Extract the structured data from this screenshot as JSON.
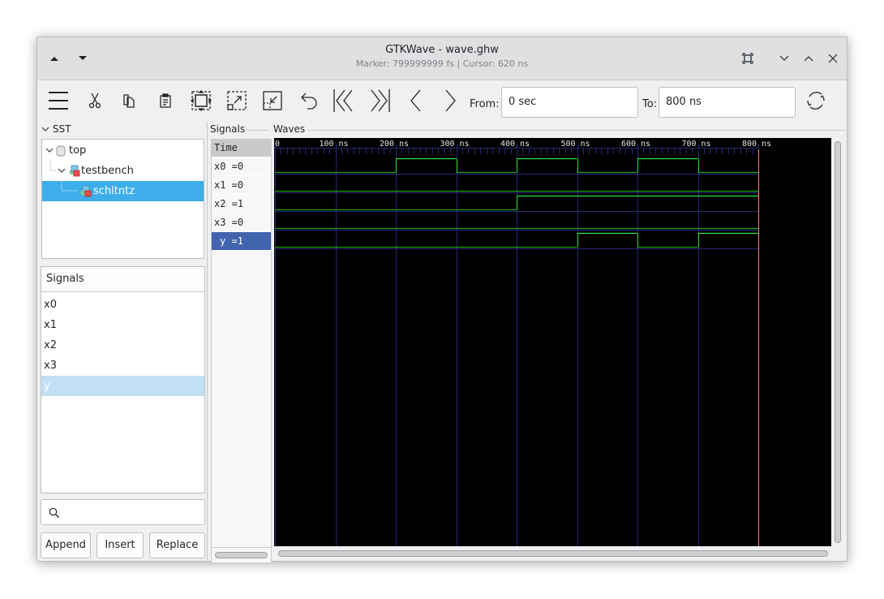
{
  "window": {
    "title": "GTKWave - wave.ghw",
    "subtitle": "Marker: 799999999 fs  |  Cursor: 620 ns"
  },
  "toolbar": {
    "from_label": "From:",
    "from_value": "0 sec",
    "to_label": "To:",
    "to_value": "800 ns",
    "icons": [
      "menu-icon",
      "cut-icon",
      "copy-icon",
      "paste-icon",
      "zoom-fit-icon",
      "zoom-in-icon",
      "zoom-out-icon",
      "undo-icon",
      "first-icon",
      "last-icon",
      "prev-icon",
      "next-icon",
      "reload-icon"
    ]
  },
  "sst": {
    "label": "SST",
    "tree": [
      {
        "label": "top",
        "level": 0,
        "icon": "database-icon",
        "expanded": true
      },
      {
        "label": "testbench",
        "level": 1,
        "icon": "module-icon",
        "expanded": true
      },
      {
        "label": "schltntz",
        "level": 2,
        "icon": "module-icon",
        "selected": true
      }
    ]
  },
  "signals_list": {
    "header": "Signals",
    "items": [
      "x0",
      "x1",
      "x2",
      "x3",
      "y"
    ],
    "selected_index": 4
  },
  "search": {
    "placeholder": ""
  },
  "buttons": {
    "append": "Append",
    "insert": "Insert",
    "replace": "Replace"
  },
  "signals_panel": {
    "label": "Signals",
    "time_label": "Time",
    "rows": [
      {
        "name": "x0",
        "value": "0",
        "text": "x0 =0"
      },
      {
        "name": "x1",
        "value": "0",
        "text": "x1 =0"
      },
      {
        "name": "x2",
        "value": "1",
        "text": "x2 =1"
      },
      {
        "name": "x3",
        "value": "0",
        "text": "x3 =0"
      },
      {
        "name": "y",
        "value": "1",
        "text": "y =1",
        "selected": true
      }
    ]
  },
  "waves": {
    "label": "Waves",
    "colors": {
      "background": "#000000",
      "grid": "#262678",
      "high": "#33e033",
      "low": "#1f9e1f",
      "marker": "#ff8080",
      "tick_text": "#e0e0e0"
    },
    "time_unit": "ns",
    "time_range": [
      0,
      800
    ],
    "marker_time": 800,
    "tick_labels": [
      "0",
      "100 ns",
      "200 ns",
      "300 ns",
      "400 ns",
      "500 ns",
      "600 ns",
      "700 ns",
      "800 ns"
    ],
    "ticks": [
      0,
      100,
      200,
      300,
      400,
      500,
      600,
      700,
      800
    ],
    "signals": [
      {
        "name": "x0",
        "transitions": [
          [
            0,
            0
          ],
          [
            200,
            1
          ],
          [
            300,
            0
          ],
          [
            400,
            1
          ],
          [
            500,
            0
          ],
          [
            600,
            1
          ],
          [
            700,
            0
          ]
        ]
      },
      {
        "name": "x1",
        "transitions": [
          [
            0,
            0
          ]
        ]
      },
      {
        "name": "x2",
        "transitions": [
          [
            0,
            0
          ],
          [
            400,
            1
          ]
        ]
      },
      {
        "name": "x3",
        "transitions": [
          [
            0,
            0
          ]
        ]
      },
      {
        "name": "y",
        "transitions": [
          [
            0,
            0
          ],
          [
            500,
            1
          ],
          [
            600,
            0
          ],
          [
            700,
            1
          ]
        ]
      }
    ]
  }
}
